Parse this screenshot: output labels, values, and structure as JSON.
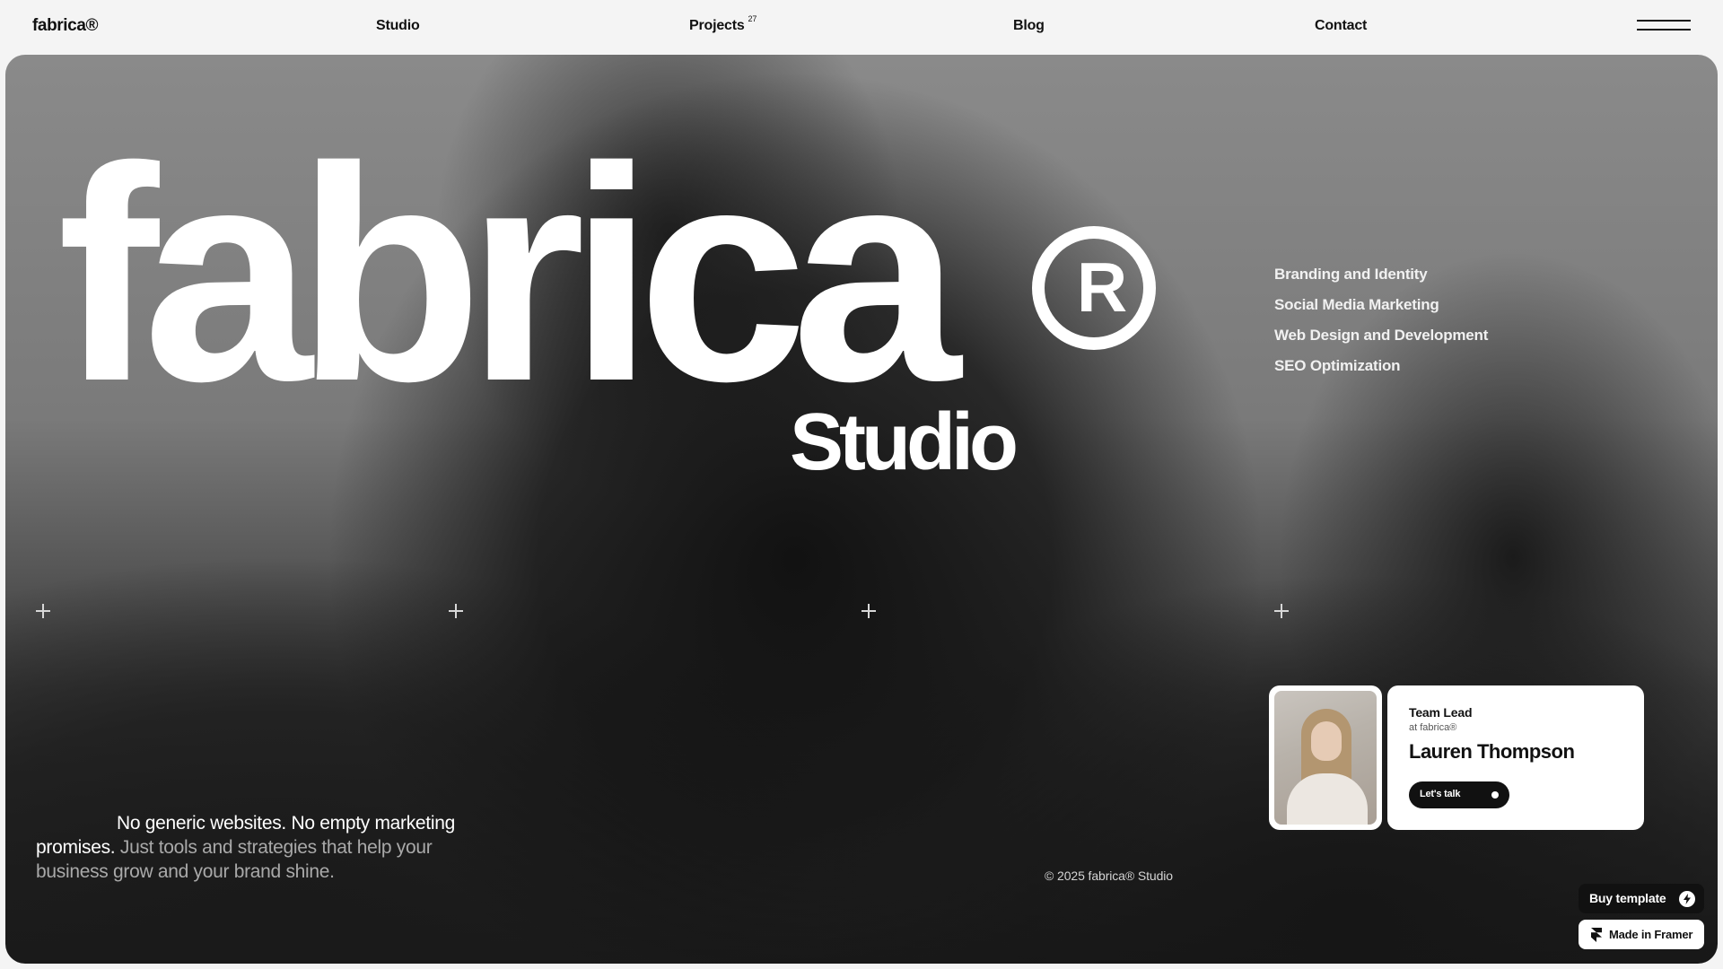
{
  "nav": {
    "logo": "fabrica®",
    "links": [
      {
        "label": "Studio"
      },
      {
        "label": "Projects",
        "count": "27"
      },
      {
        "label": "Blog"
      },
      {
        "label": "Contact"
      }
    ],
    "menu_icon": "hamburger-icon"
  },
  "hero": {
    "title": "fabrica",
    "title_mark": "registered-trademark-icon",
    "subtitle": "Studio",
    "services": [
      "Branding and Identity",
      "Social Media Marketing",
      "Web Design and Development",
      "SEO Optimization"
    ],
    "tagline_strong": "No generic websites. No empty marketing promises.",
    "tagline_muted": "Just tools and strategies that help your business grow and your brand shine.",
    "copyright": "© 2025 fabrica® Studio"
  },
  "team_card": {
    "role": "Team Lead",
    "company": "at fabrica®",
    "name": "Lauren Thompson",
    "cta": "Let's talk"
  },
  "badges": {
    "buy": "Buy template",
    "framer": "Made in Framer"
  },
  "colors": {
    "page_bg": "#f4f4f4",
    "ink": "#111111",
    "hero_text": "#ffffff"
  }
}
